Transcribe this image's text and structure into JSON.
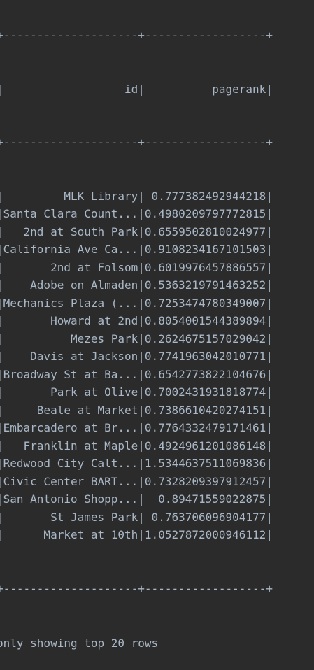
{
  "table": {
    "border": "+--------------------+------------------+",
    "columns": [
      "id",
      "pagerank"
    ],
    "header_line": "|                  id|          pagerank|",
    "rows": [
      {
        "id": "MLK Library",
        "pagerank": "0.777382492944218",
        "line": "|         MLK Library| 0.777382492944218|"
      },
      {
        "id": "Santa Clara Count...",
        "pagerank": "0.4980209797772815",
        "line": "|Santa Clara Count...|0.4980209797772815|"
      },
      {
        "id": "2nd at South Park",
        "pagerank": "0.6559502810024977",
        "line": "|   2nd at South Park|0.6559502810024977|"
      },
      {
        "id": "California Ave Ca...",
        "pagerank": "0.9108234167101503",
        "line": "|California Ave Ca...|0.9108234167101503|"
      },
      {
        "id": "2nd at Folsom",
        "pagerank": "0.6019976457886557",
        "line": "|       2nd at Folsom|0.6019976457886557|"
      },
      {
        "id": "Adobe on Almaden",
        "pagerank": "0.5363219791463252",
        "line": "|    Adobe on Almaden|0.5363219791463252|"
      },
      {
        "id": "Mechanics Plaza (...",
        "pagerank": "0.7253474780349007",
        "line": "|Mechanics Plaza (...|0.7253474780349007|"
      },
      {
        "id": "Howard at 2nd",
        "pagerank": "0.8054001544389894",
        "line": "|       Howard at 2nd|0.8054001544389894|"
      },
      {
        "id": "Mezes Park",
        "pagerank": "0.2624675157029042",
        "line": "|          Mezes Park|0.2624675157029042|"
      },
      {
        "id": "Davis at Jackson",
        "pagerank": "0.7741963042010771",
        "line": "|    Davis at Jackson|0.7741963042010771|"
      },
      {
        "id": "Broadway St at Ba...",
        "pagerank": "0.6542773822104676",
        "line": "|Broadway St at Ba...|0.6542773822104676|"
      },
      {
        "id": "Park at Olive",
        "pagerank": "0.7002431931818774",
        "line": "|       Park at Olive|0.7002431931818774|"
      },
      {
        "id": "Beale at Market",
        "pagerank": "0.7386610420274151",
        "line": "|     Beale at Market|0.7386610420274151|"
      },
      {
        "id": "Embarcadero at Br...",
        "pagerank": "0.7764332479171461",
        "line": "|Embarcadero at Br...|0.7764332479171461|"
      },
      {
        "id": "Franklin at Maple",
        "pagerank": "0.4924961201086148",
        "line": "|   Franklin at Maple|0.4924961201086148|"
      },
      {
        "id": "Redwood City Calt...",
        "pagerank": "1.5344637511069836",
        "line": "|Redwood City Calt...|1.5344637511069836|"
      },
      {
        "id": "Civic Center BART...",
        "pagerank": "0.7328209397912457",
        "line": "|Civic Center BART...|0.7328209397912457|"
      },
      {
        "id": "San Antonio Shopp...",
        "pagerank": "0.89471559022875",
        "line": "|San Antonio Shopp...|  0.89471559022875|"
      },
      {
        "id": "St James Park",
        "pagerank": "0.763706096904177",
        "line": "|       St James Park| 0.763706096904177|"
      },
      {
        "id": "Market at 10th",
        "pagerank": "1.0527872000946112",
        "line": "|      Market at 10th|1.0527872000946112|"
      }
    ]
  },
  "footer": "only showing top 20 rows",
  "colors": {
    "background": "#2b2b2b",
    "text": "#a9b7c6"
  }
}
